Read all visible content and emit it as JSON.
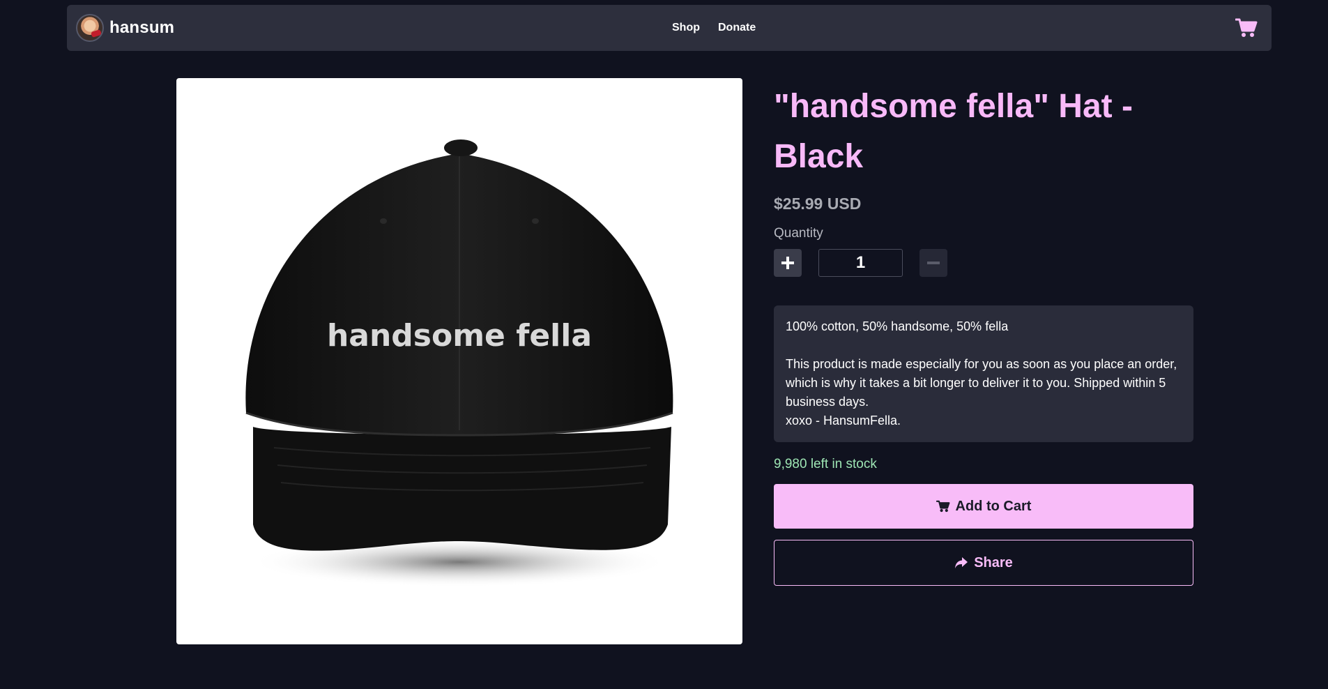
{
  "navbar": {
    "brand": "hansum",
    "links": [
      {
        "label": "Shop"
      },
      {
        "label": "Donate"
      }
    ],
    "cart_icon": "shopping-cart-icon"
  },
  "product": {
    "image_text": "handsome fella",
    "title": "\"handsome fella\" Hat - Black",
    "price": "$25.99 USD",
    "quantity_label": "Quantity",
    "quantity_value": "1",
    "description": {
      "line1": "100% cotton, 50% handsome, 50% fella",
      "line2": "This product is made especially for you as soon as you place an order, which is why it takes a bit longer to deliver it to you. Shipped within 5 business days.",
      "line3": "xoxo - HansumFella."
    },
    "stock": "9,980 left in stock",
    "add_to_cart_label": "Add to Cart",
    "share_label": "Share"
  },
  "colors": {
    "background": "#10121f",
    "navbar": "#2d2f3d",
    "accent_pink": "#f8bcf8",
    "stock_green": "#9ee6b4"
  }
}
